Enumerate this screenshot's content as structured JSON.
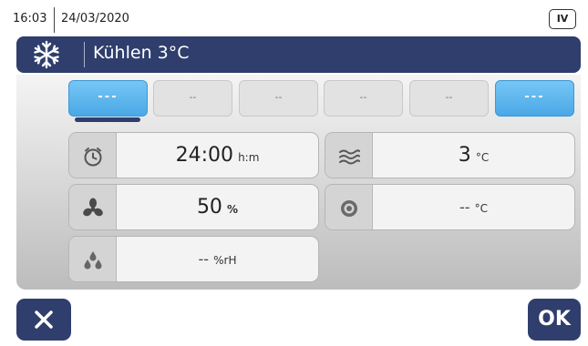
{
  "status": {
    "time": "16:03",
    "date": "24/03/2020",
    "badge": "IV"
  },
  "header": {
    "title": "Kühlen 3°C",
    "icon": "snowflake-icon"
  },
  "steps": [
    {
      "label": "---",
      "active": true
    },
    {
      "label": "--",
      "active": false
    },
    {
      "label": "--",
      "active": false
    },
    {
      "label": "--",
      "active": false
    },
    {
      "label": "--",
      "active": false
    },
    {
      "label": "---",
      "active": true
    }
  ],
  "fields": {
    "time": {
      "value": "24:00",
      "unit": "h:m",
      "icon": "clock-icon"
    },
    "air_speed": {
      "value": "3",
      "unit": "°C",
      "icon": "airflow-icon"
    },
    "fan": {
      "value": "50",
      "unit": "%",
      "icon": "fan-icon"
    },
    "core_temp": {
      "value": "--",
      "unit": "°C",
      "icon": "probe-icon"
    },
    "humidity": {
      "value": "--",
      "unit": "%rH",
      "icon": "humidity-icon"
    }
  },
  "buttons": {
    "cancel_icon": "close-icon",
    "ok_label": "OK"
  },
  "colors": {
    "header_bg": "#2f3e6c",
    "active_step": "#4aa8e6",
    "panel_light": "#f4f4f4",
    "panel_dark": "#bcbcbc"
  }
}
